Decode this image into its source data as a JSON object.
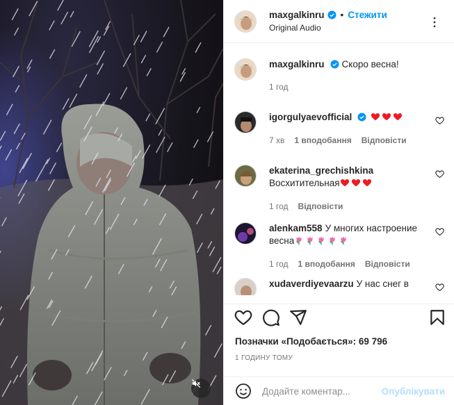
{
  "post": {
    "username": "maxgalkinru",
    "follow_label": "Стежити",
    "audio_label": "Original Audio"
  },
  "caption": {
    "username": "maxgalkinru",
    "text": "Скоро весна!",
    "time": "1 год"
  },
  "comments": [
    {
      "username": "igorgulyaevofficial",
      "verified": true,
      "text": "",
      "emoji": [
        "heart",
        "heart",
        "heart"
      ],
      "time": "7 хв",
      "likes": "1 вподобання",
      "reply": "Відповісти"
    },
    {
      "username": "ekaterina_grechishkina",
      "verified": false,
      "text": "Восхитительная",
      "emoji": [
        "heart",
        "heart",
        "heart"
      ],
      "time": "1 год",
      "likes": "",
      "reply": "Відповісти"
    },
    {
      "username": "alenkam558",
      "verified": false,
      "text": "У многих настроение весна",
      "emoji": [
        "tulip",
        "tulip",
        "tulip",
        "tulip",
        "tulip"
      ],
      "time": "1 год",
      "likes": "1 вподобання",
      "reply": "Відповісти"
    },
    {
      "username": "xudaverdiyevaarzu",
      "verified": false,
      "text": "У нас снег в",
      "emoji": [],
      "time": "",
      "likes": "",
      "reply": ""
    }
  ],
  "likes_text": "Позначки «Подобається»: 69 796",
  "time_ago": "1 ГОДИНУ ТОМУ",
  "composer": {
    "placeholder": "Додайте коментар...",
    "post_label": "Опублікувати"
  },
  "colors": {
    "accent": "#0095f6",
    "heart": "#ed1c24",
    "muted": "#737373"
  },
  "icons": [
    "more-icon",
    "verified-icon",
    "heart-icon",
    "comment-icon",
    "share-icon",
    "bookmark-icon",
    "emoji-icon",
    "mute-icon"
  ]
}
